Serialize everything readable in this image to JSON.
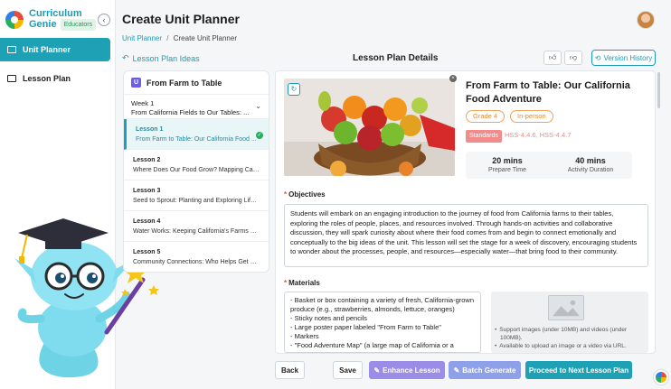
{
  "app": {
    "brand_line1": "Curriculum",
    "brand_line2": "Genie",
    "brand_badge": "Educators",
    "collapse_icon": "chevron-left-icon"
  },
  "sidebar": {
    "items": [
      {
        "label": "Unit Planner",
        "icon": "layout-icon",
        "active": true
      },
      {
        "label": "Lesson Plan",
        "icon": "book-icon",
        "active": false
      }
    ]
  },
  "header": {
    "title": "Create Unit Planner",
    "breadcrumb": [
      "Unit Planner",
      "Create Unit Planner"
    ]
  },
  "toolbar": {
    "back_link": "Lesson Plan Ideas",
    "section_title": "Lesson Plan Details",
    "version_history": "Version History"
  },
  "unit": {
    "title": "From Farm to Table",
    "week_label": "Week 1",
    "week_title": "From California Fields to Our Tables: ...",
    "lessons": [
      {
        "number": "Lesson 1",
        "title": "From Farm to Table: Our California Food ...",
        "active": true
      },
      {
        "number": "Lesson 2",
        "title": "Where Does Our Food Grow? Mapping Calif...",
        "active": false
      },
      {
        "number": "Lesson 3",
        "title": "Seed to Sprout: Planting and Exploring Life ...",
        "active": false
      },
      {
        "number": "Lesson 4",
        "title": "Water Works: Keeping California's Farms Gr...",
        "active": false
      },
      {
        "number": "Lesson 5",
        "title": "Community Connections: Who Helps Get Fo...",
        "active": false
      }
    ]
  },
  "lesson": {
    "title": "From Farm to Table: Our California Food Adventure",
    "grade": "Grade 4",
    "mode": "In-person",
    "standards_label": "Standards",
    "standards": "HSS-4.4.6, HSS-4.4.7",
    "prepare_time": "20 mins",
    "prepare_label": "Prepare Time",
    "activity_time": "40 mins",
    "activity_label": "Activity Duration",
    "objectives_label": "Objectives",
    "objectives": "Students will embark on an engaging introduction to the journey of food from California farms to their tables, exploring the roles of people, places, and resources involved. Through hands-on activities and collaborative discussion, they will spark curiosity about where their food comes from and begin to connect emotionally and conceptually to the big ideas of the unit. This lesson will set the stage for a week of discovery, encouraging students to wonder about the processes, people, and resources—especially water—that bring food to their community.",
    "materials_label": "Materials",
    "materials": [
      "- Basket or box containing a variety of fresh, California-grown produce (e.g., strawberries, almonds, lettuce, oranges)",
      "- Sticky notes and pencils",
      "- Large poster paper labeled \"From Farm to Table\"",
      "- Markers",
      "- \"Food Adventure Map\" (a large map of California or a"
    ],
    "upload_notes": [
      "Support images (under 10MB) and videos (under 100MB).",
      "Available to upload an image or a video via URL."
    ]
  },
  "actions": {
    "back": "Back",
    "save": "Save",
    "enhance": "Enhance Lesson",
    "batch": "Batch Generate",
    "next": "Proceed to Next Lesson Plan"
  }
}
